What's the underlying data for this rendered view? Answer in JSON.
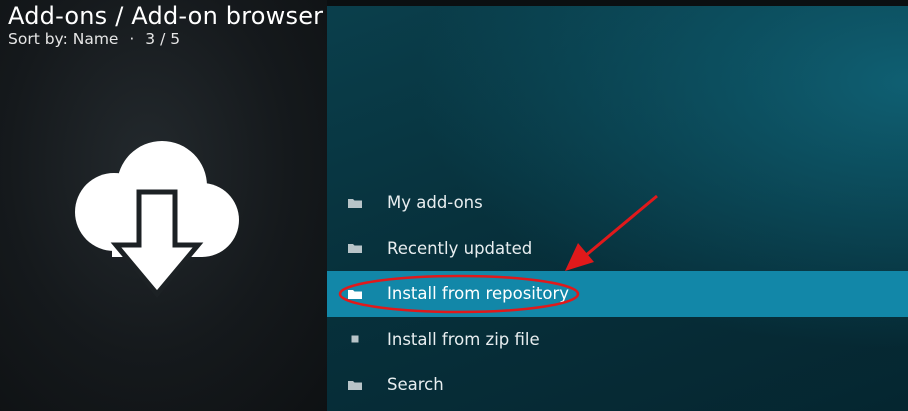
{
  "header": {
    "title": "Add-ons / Add-on browser",
    "sort_by": "Sort by: Name",
    "separator": "·",
    "position": "3 / 5"
  },
  "menu": {
    "items": [
      {
        "label": "My add-ons",
        "icon": "folder-icon"
      },
      {
        "label": "Recently updated",
        "icon": "folder-icon"
      },
      {
        "label": "Install from repository",
        "icon": "folder-icon",
        "selected": true
      },
      {
        "label": "Install from zip file",
        "icon": "square-bullet-icon"
      },
      {
        "label": "Search",
        "icon": "folder-icon"
      }
    ]
  },
  "preview": {
    "icon": "cloud-download-icon"
  },
  "colors": {
    "selected_bg": "#1287a8",
    "annotation": "#e0191b"
  }
}
